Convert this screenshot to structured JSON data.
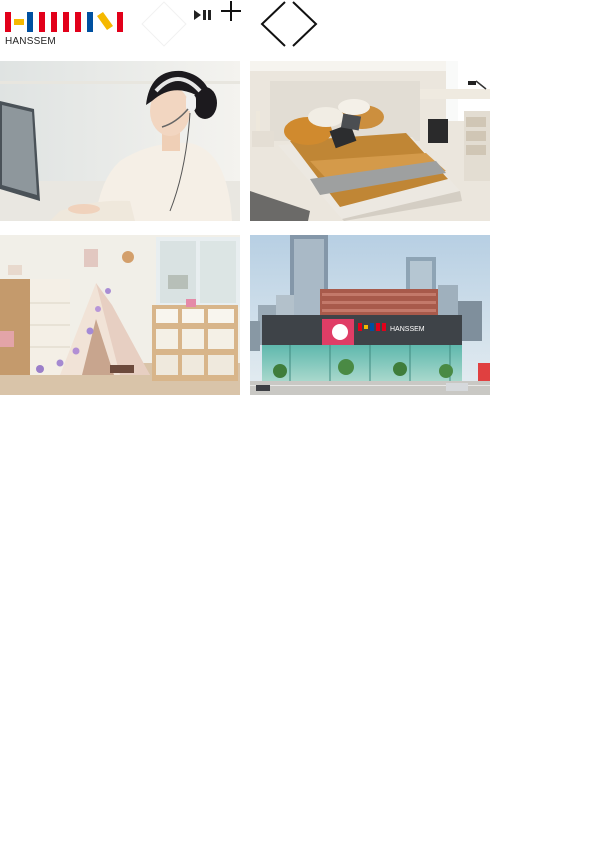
{
  "brand": {
    "wordmark": "HANSSEM",
    "logo_colors": [
      "#e2001a",
      "#f5b800",
      "#0050a0"
    ]
  },
  "controls": {
    "diamond_icon": "diamond-icon",
    "playpause_icon": "play-pause-icon",
    "plus_icon": "plus-icon",
    "prev_icon": "chevron-left-icon",
    "next_icon": "chevron-right-icon"
  },
  "tiles": [
    {
      "image": "customer-service-agent-with-headset"
    },
    {
      "image": "bedroom-with-mustard-bedding"
    },
    {
      "image": "kids-room-with-play-tent"
    },
    {
      "image": "hanssem-store-building"
    }
  ],
  "store_sign": {
    "wordmark": "HANSSEM"
  }
}
